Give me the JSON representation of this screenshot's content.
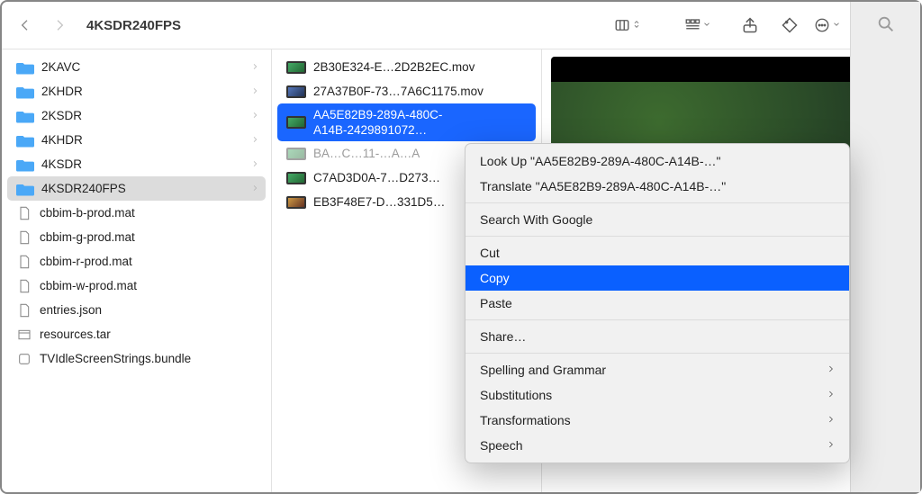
{
  "window": {
    "title": "4KSDR240FPS"
  },
  "sidebar": {
    "items": [
      {
        "name": "2KAVC",
        "type": "folder",
        "hasChildren": true
      },
      {
        "name": "2KHDR",
        "type": "folder",
        "hasChildren": true
      },
      {
        "name": "2KSDR",
        "type": "folder",
        "hasChildren": true
      },
      {
        "name": "4KHDR",
        "type": "folder",
        "hasChildren": true
      },
      {
        "name": "4KSDR",
        "type": "folder",
        "hasChildren": true
      },
      {
        "name": "4KSDR240FPS",
        "type": "folder",
        "hasChildren": true,
        "selected": true
      },
      {
        "name": "cbbim-b-prod.mat",
        "type": "file"
      },
      {
        "name": "cbbim-g-prod.mat",
        "type": "file"
      },
      {
        "name": "cbbim-r-prod.mat",
        "type": "file"
      },
      {
        "name": "cbbim-w-prod.mat",
        "type": "file"
      },
      {
        "name": "entries.json",
        "type": "file"
      },
      {
        "name": "resources.tar",
        "type": "file"
      },
      {
        "name": "TVIdleScreenStrings.bundle",
        "type": "bundle"
      }
    ]
  },
  "files": {
    "items": [
      {
        "name": "2B30E324-E…2D2B2EC.mov",
        "vstyle": ""
      },
      {
        "name": "27A37B0F-73…7A6C1175.mov",
        "vstyle": "v2"
      },
      {
        "line1": "AA5E82B9-289A-480C-",
        "line2": "A14B-2429891072…",
        "selected": true
      },
      {
        "name": "BA…C…11-…A…A",
        "vstyle": "",
        "dim": true
      },
      {
        "name": "C7AD3D0A-7…D273…",
        "vstyle": ""
      },
      {
        "name": "EB3F48E7-D…331D5…",
        "vstyle": "v3"
      }
    ]
  },
  "contextMenu": {
    "lookup": "Look Up \"AA5E82B9-289A-480C-A14B-…\"",
    "translate": "Translate \"AA5E82B9-289A-480C-A14B-…\"",
    "searchGoogle": "Search With Google",
    "cut": "Cut",
    "copy": "Copy",
    "paste": "Paste",
    "share": "Share…",
    "spelling": "Spelling and Grammar",
    "subs": "Substitutions",
    "trans": "Transformations",
    "speech": "Speech",
    "highlighted": "copy"
  }
}
